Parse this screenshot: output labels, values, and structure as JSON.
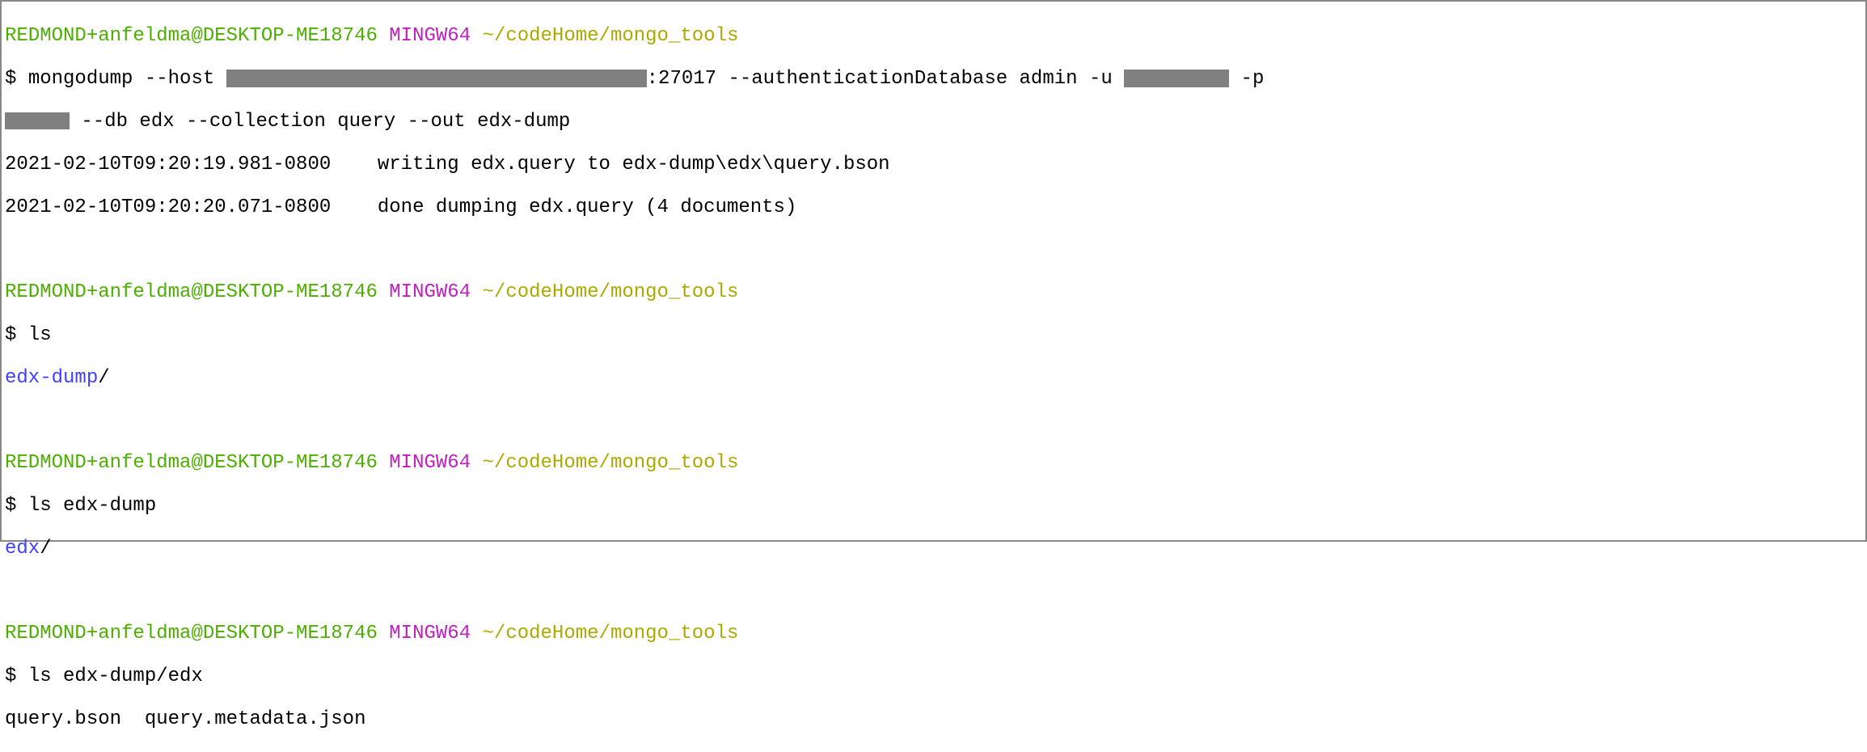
{
  "prompts": {
    "userHost": "REDMOND+anfeldma@DESKTOP-ME18746",
    "mingw": "MINGW64",
    "path": "~/codeHome/mongo_tools",
    "symbol": "$"
  },
  "block1": {
    "cmd_a": "mongodump --host ",
    "cmd_b": ":27017 --authenticationDatabase admin -u ",
    "cmd_c": " -p ",
    "cmd_d": " --db edx --collection query --out edx-dump",
    "out1": "2021-02-10T09:20:19.981-0800    writing edx.query to edx-dump\\edx\\query.bson",
    "out2": "2021-02-10T09:20:20.071-0800    done dumping edx.query (4 documents)"
  },
  "block2": {
    "cmd": "ls",
    "out_dir": "edx-dump",
    "out_slash": "/"
  },
  "block3": {
    "cmd": "ls edx-dump",
    "out_dir": "edx",
    "out_slash": "/"
  },
  "block4": {
    "cmd": "ls edx-dump/edx",
    "out": "query.bson  query.metadata.json"
  }
}
